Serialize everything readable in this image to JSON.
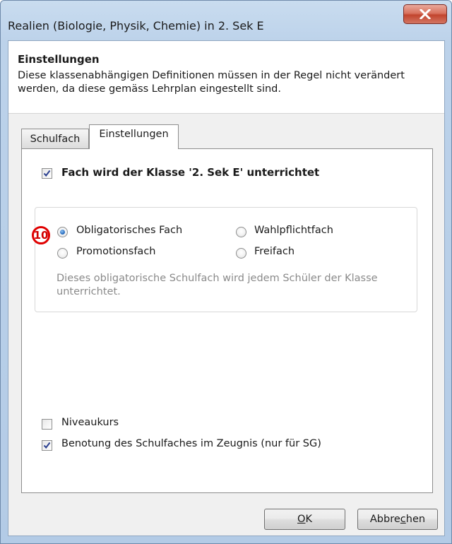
{
  "window": {
    "title": "Realien (Biologie, Physik, Chemie) in 2. Sek E",
    "close_symbol": "X",
    "close_icon": "close-icon"
  },
  "header": {
    "title": "Einstellungen",
    "description": "Diese klassenabhängigen Definitionen müssen in der Regel nicht verändert werden, da diese gemäss Lehrplan eingestellt sind."
  },
  "tabs": [
    {
      "label": "Schulfach",
      "active": false
    },
    {
      "label": "Einstellungen",
      "active": true
    }
  ],
  "settings": {
    "taught_checkbox": {
      "label": "Fach wird der Klasse '2. Sek E' unterrichtet",
      "checked": true
    },
    "annotation_badge": "10",
    "radios": [
      {
        "label": "Obligatorisches Fach",
        "checked": true
      },
      {
        "label": "Wahlpflichtfach",
        "checked": false
      },
      {
        "label": "Promotionsfach",
        "checked": false
      },
      {
        "label": "Freifach",
        "checked": false
      }
    ],
    "hint": "Dieses obligatorische Schulfach wird jedem Schüler der Klasse unterrichtet.",
    "niveaukurs": {
      "label": "Niveaukurs",
      "checked": false
    },
    "benotung": {
      "label": "Benotung des Schulfaches im Zeugnis (nur für SG)",
      "checked": true
    }
  },
  "buttons": {
    "ok": {
      "label": "OK",
      "mnemonic_index": 0
    },
    "cancel": {
      "label": "Abbrechen",
      "mnemonic_index": 5
    }
  },
  "colors": {
    "accent_radio": "#2b6fc0",
    "badge_red": "#e00000",
    "close_red": "#c2452e"
  }
}
